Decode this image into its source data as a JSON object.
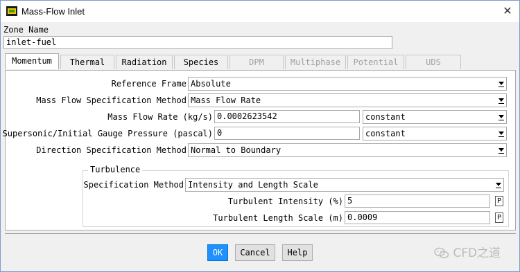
{
  "window": {
    "title": "Mass-Flow Inlet",
    "close_glyph": "✕"
  },
  "zone": {
    "label": "Zone Name",
    "value": "inlet-fuel"
  },
  "tabs": [
    {
      "label": "Momentum",
      "state": "active"
    },
    {
      "label": "Thermal",
      "state": "enabled"
    },
    {
      "label": "Radiation",
      "state": "enabled"
    },
    {
      "label": "Species",
      "state": "enabled"
    },
    {
      "label": "DPM",
      "state": "disabled"
    },
    {
      "label": "Multiphase",
      "state": "disabled"
    },
    {
      "label": "Potential",
      "state": "disabled"
    },
    {
      "label": "UDS",
      "state": "disabled"
    }
  ],
  "momentum": {
    "reference_frame": {
      "label": "Reference Frame",
      "value": "Absolute"
    },
    "mass_flow_method": {
      "label": "Mass Flow Specification Method",
      "value": "Mass Flow Rate"
    },
    "mass_flow_rate": {
      "label": "Mass Flow Rate (kg/s)",
      "value": "0.0002623542",
      "profile": "constant"
    },
    "gauge_pressure": {
      "label": "Supersonic/Initial Gauge Pressure (pascal)",
      "value": "0",
      "profile": "constant"
    },
    "direction_method": {
      "label": "Direction Specification Method",
      "value": "Normal to Boundary"
    },
    "turbulence": {
      "title": "Turbulence",
      "method": {
        "label": "Specification Method",
        "value": "Intensity and Length Scale"
      },
      "intensity": {
        "label": "Turbulent Intensity (%)",
        "value": "5",
        "p": "P"
      },
      "length_scale": {
        "label": "Turbulent Length Scale (m)",
        "value": "0.0009",
        "p": "P"
      }
    }
  },
  "buttons": {
    "ok": "OK",
    "cancel": "Cancel",
    "help": "Help"
  },
  "watermark": {
    "text": "CFD之道",
    "icon": "wechat-icon"
  },
  "colors": {
    "ok_button": "#1e90ff",
    "panel": "#ffffff",
    "window": "#f0f0f0"
  }
}
